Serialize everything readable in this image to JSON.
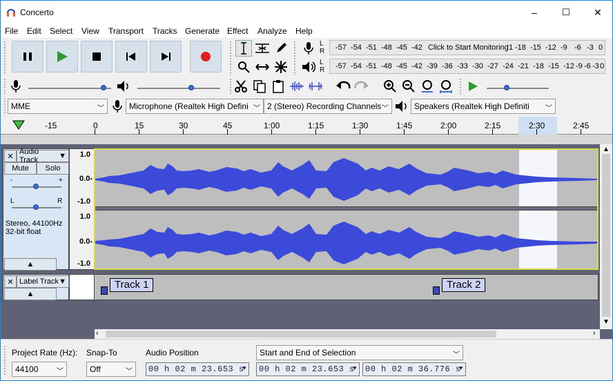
{
  "window": {
    "title": "Concerto",
    "controls": [
      "–",
      "☐",
      "✕"
    ]
  },
  "menu": [
    "File",
    "Edit",
    "Select",
    "View",
    "Transport",
    "Tracks",
    "Generate",
    "Effect",
    "Analyze",
    "Help"
  ],
  "meters": {
    "record_ticks": [
      "-57",
      "-54",
      "-51",
      "-48",
      "-45",
      "-42",
      "-3",
      "!1",
      "-18",
      "-15",
      "-12",
      "-9",
      "-6",
      "-3",
      "0"
    ],
    "record_message": "Click to Start Monitoring",
    "play_ticks": [
      "-57",
      "-54",
      "-51",
      "-48",
      "-45",
      "-42",
      "-39",
      "-36",
      "-33",
      "-30",
      "-27",
      "-24",
      "-21",
      "-18",
      "-15",
      "-12",
      "-9",
      "-6",
      "-3",
      "0"
    ],
    "record_channel_labels": [
      "L",
      "R"
    ],
    "play_channel_labels": [
      "L",
      "R"
    ]
  },
  "device": {
    "host": "MME",
    "recording_device": "Microphone (Realtek High Defini",
    "channels": "2 (Stereo) Recording Channels",
    "playback_device": "Speakers (Realtek High Definiti"
  },
  "ruler": {
    "labels": [
      "-15",
      "0",
      "15",
      "30",
      "45",
      "1:00",
      "1:15",
      "1:30",
      "1:45",
      "2:00",
      "2:15",
      "2:30",
      "2:45"
    ]
  },
  "audio_track": {
    "name": "Audio Track",
    "mute_label": "Mute",
    "solo_label": "Solo",
    "gain_minus": "-",
    "gain_plus": "+",
    "pan_left": "L",
    "pan_right": "R",
    "info_line1": "Stereo, 44100Hz",
    "info_line2": "32-bit float",
    "scale_top": [
      "1.0",
      "0.0-",
      "-1.0"
    ],
    "scale_bottom": [
      "1.0",
      "0.0-",
      "-1.0"
    ]
  },
  "label_track": {
    "name": "Label Track",
    "labels": [
      "Track 1",
      "Track 2"
    ]
  },
  "bottom": {
    "project_rate_label": "Project Rate (Hz):",
    "project_rate_value": "44100",
    "snap_to_label": "Snap-To",
    "snap_to_value": "Off",
    "audio_position_label": "Audio Position",
    "audio_position_value": "00 h 02 m 23.653 s",
    "selection_mode": "Start and End of Selection",
    "selection_start": "00 h 02 m 23.653 s",
    "selection_end": "00 h 02 m 36.776 s"
  },
  "colors": {
    "accent": "#1883d7",
    "waveform": "#3b4ad9",
    "track_panel": "#d9e6f5",
    "selection": "#ffffff",
    "record_red": "#e02020",
    "play_green": "#2f9a2f"
  }
}
